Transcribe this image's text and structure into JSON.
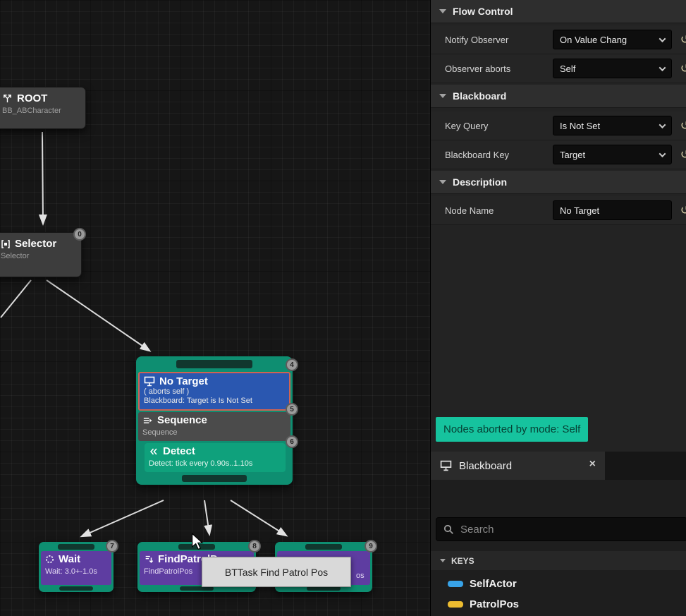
{
  "graph": {
    "nodes": {
      "root": {
        "title": "ROOT",
        "subtitle": "BB_ABCharacter"
      },
      "selector": {
        "title": "Selector",
        "subtitle": "Selector",
        "badge": "0"
      },
      "no_target_decorator": {
        "title": "No Target",
        "aborts_line": "( aborts self )",
        "condition_line": "Blackboard: Target is Is Not Set",
        "badge": "4"
      },
      "sequence": {
        "title": "Sequence",
        "subtitle": "Sequence",
        "badge": "5"
      },
      "detect_service": {
        "title": "Detect",
        "subtitle": "Detect: tick every 0.90s..1.10s",
        "badge": "6"
      },
      "wait": {
        "title": "Wait",
        "subtitle": "Wait: 3.0+-1.0s",
        "badge": "7"
      },
      "find_patrol": {
        "title": "FindPatrolPos",
        "subtitle": "FindPatrolPos",
        "badge": "8"
      },
      "third_task": {
        "subtitle_fragment": "os",
        "badge": "9"
      }
    },
    "tooltip": "BTTask Find Patrol Pos"
  },
  "details": {
    "flow_control_header": "Flow Control",
    "blackboard_header": "Blackboard",
    "description_header": "Description",
    "rows": {
      "notify_observer": {
        "label": "Notify Observer",
        "value": "On Value Chang"
      },
      "observer_aborts": {
        "label": "Observer aborts",
        "value": "Self"
      },
      "key_query": {
        "label": "Key Query",
        "value": "Is Not Set"
      },
      "blackboard_key": {
        "label": "Blackboard Key",
        "value": "Target"
      },
      "node_name": {
        "label": "Node Name",
        "value": "No Target"
      }
    },
    "reset_glyph": "↺",
    "notice": "Nodes aborted by mode: Self",
    "notice_color": "#16c39e"
  },
  "blackboard": {
    "tab_label": "Blackboard",
    "close_glyph": "×",
    "search_placeholder": "Search",
    "keys_header": "KEYS",
    "keys": [
      {
        "name": "SelfActor",
        "color": "#38a3e8"
      },
      {
        "name": "PatrolPos",
        "color": "#edbc30"
      }
    ]
  }
}
